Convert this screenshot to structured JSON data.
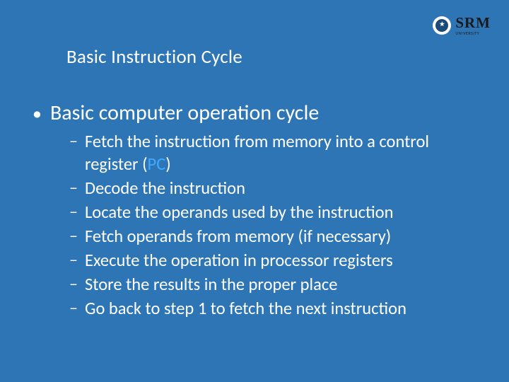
{
  "colors": {
    "background": "#2e75b6",
    "text": "#ffffff",
    "accent_link": "#3fa9ff"
  },
  "logo": {
    "main": "SRM",
    "sub": "UNIVERSITY"
  },
  "title": "Basic Instruction Cycle",
  "main_bullet": "Basic computer operation cycle",
  "sub": {
    "s1_pre": "Fetch the instruction from memory into a control register ",
    "s1_paren_open": "(",
    "s1_pc": "PC",
    "s1_paren_close": ")",
    "s2": "Decode the instruction",
    "s3": "Locate the operands used by the instruction",
    "s4": "Fetch operands from memory (if necessary)",
    "s5": "Execute the operation in processor registers",
    "s6": "Store the results in the proper place",
    "s7": "Go back to step 1 to fetch the next instruction"
  }
}
